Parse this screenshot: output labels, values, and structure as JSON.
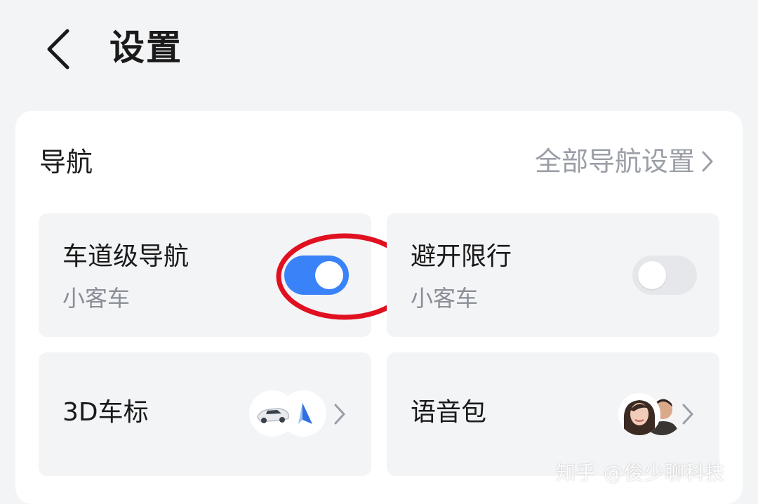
{
  "header": {
    "title": "设置",
    "back_icon": "chevron-left-icon"
  },
  "section": {
    "title": "导航",
    "link_label": "全部导航设置",
    "link_icon": "chevron-right-icon"
  },
  "tiles": [
    {
      "title": "车道级导航",
      "subtitle": "小客车",
      "toggle_on": true,
      "accent": "#3a82f7",
      "highlight_color": "#e01020"
    },
    {
      "title": "避开限行",
      "subtitle": "小客车",
      "toggle_on": false
    },
    {
      "title": "3D车标",
      "icons": [
        "car-preview-icon",
        "arrow-marker-icon",
        "chevron-right-icon"
      ]
    },
    {
      "title": "语音包",
      "icons": [
        "voice-avatar-woman-icon",
        "voice-avatar-man-icon",
        "chevron-right-icon"
      ]
    }
  ],
  "watermark": "知乎 @俊少聊科技"
}
